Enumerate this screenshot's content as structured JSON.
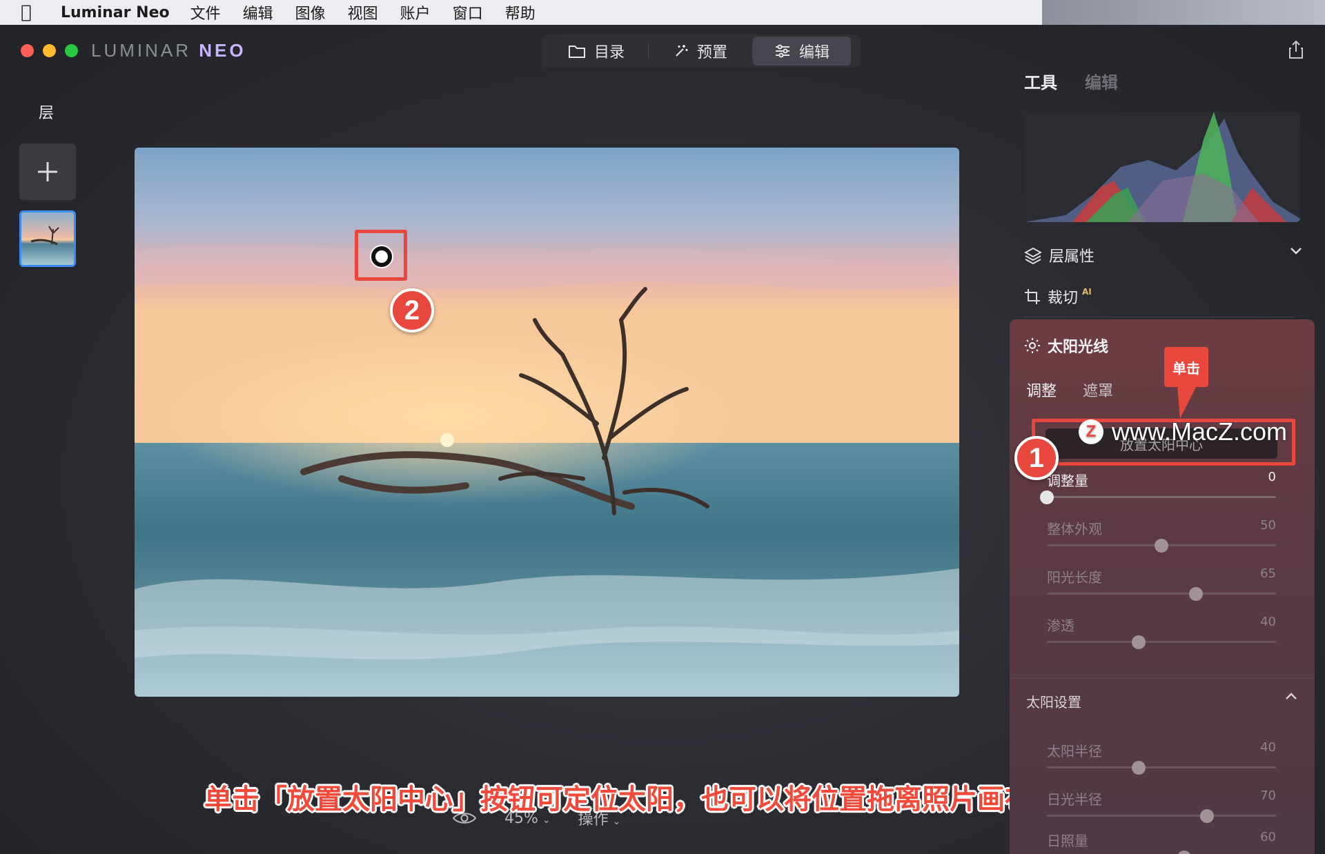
{
  "menubar": {
    "app_name": "Luminar Neo",
    "items": [
      "文件",
      "编辑",
      "图像",
      "视图",
      "账户",
      "窗口",
      "帮助"
    ]
  },
  "window": {
    "logo_left": "LUMINAR",
    "logo_right": "NEO",
    "nav": {
      "catalog": "目录",
      "presets": "预置",
      "edit": "编辑"
    }
  },
  "layers": {
    "title": "层"
  },
  "bottom_bar": {
    "zoom": "45%",
    "actions": "操作"
  },
  "caption": "单击「放置太阳中心」按钮可定位太阳，也可以将位置拖离照片画布",
  "annotations": {
    "badge_1": "1",
    "badge_2": "2",
    "click_callout": "单击",
    "watermark": "www.MacZ.com",
    "watermark_logo": "Z"
  },
  "panel": {
    "tabs": {
      "tools": "工具",
      "edits": "编辑"
    },
    "layer_properties": "层属性",
    "crop": "裁切",
    "crop_badge": "AI",
    "sunrays": {
      "title": "太阳光线",
      "subtabs": {
        "adjust": "调整",
        "mask": "遮罩"
      },
      "place_sun_button": "放置太阳中心",
      "sliders": [
        {
          "label": "调整量",
          "value": "0",
          "fraction": 0.0,
          "active": true
        },
        {
          "label": "整体外观",
          "value": "50",
          "fraction": 0.5,
          "active": false
        },
        {
          "label": "阳光长度",
          "value": "65",
          "fraction": 0.65,
          "active": false
        },
        {
          "label": "渗透",
          "value": "40",
          "fraction": 0.4,
          "active": false
        }
      ],
      "sun_settings": {
        "title": "太阳设置",
        "sliders": [
          {
            "label": "太阳半径",
            "value": "40",
            "fraction": 0.4,
            "active": false
          },
          {
            "label": "日光半径",
            "value": "70",
            "fraction": 0.7,
            "active": false
          },
          {
            "label": "日照量",
            "value": "60",
            "fraction": 0.6,
            "active": false
          }
        ]
      }
    }
  },
  "colors": {
    "accent_red": "#e8473d",
    "selected_layer": "#3b8cf0",
    "sunrays_panel": "#6a3c42"
  }
}
